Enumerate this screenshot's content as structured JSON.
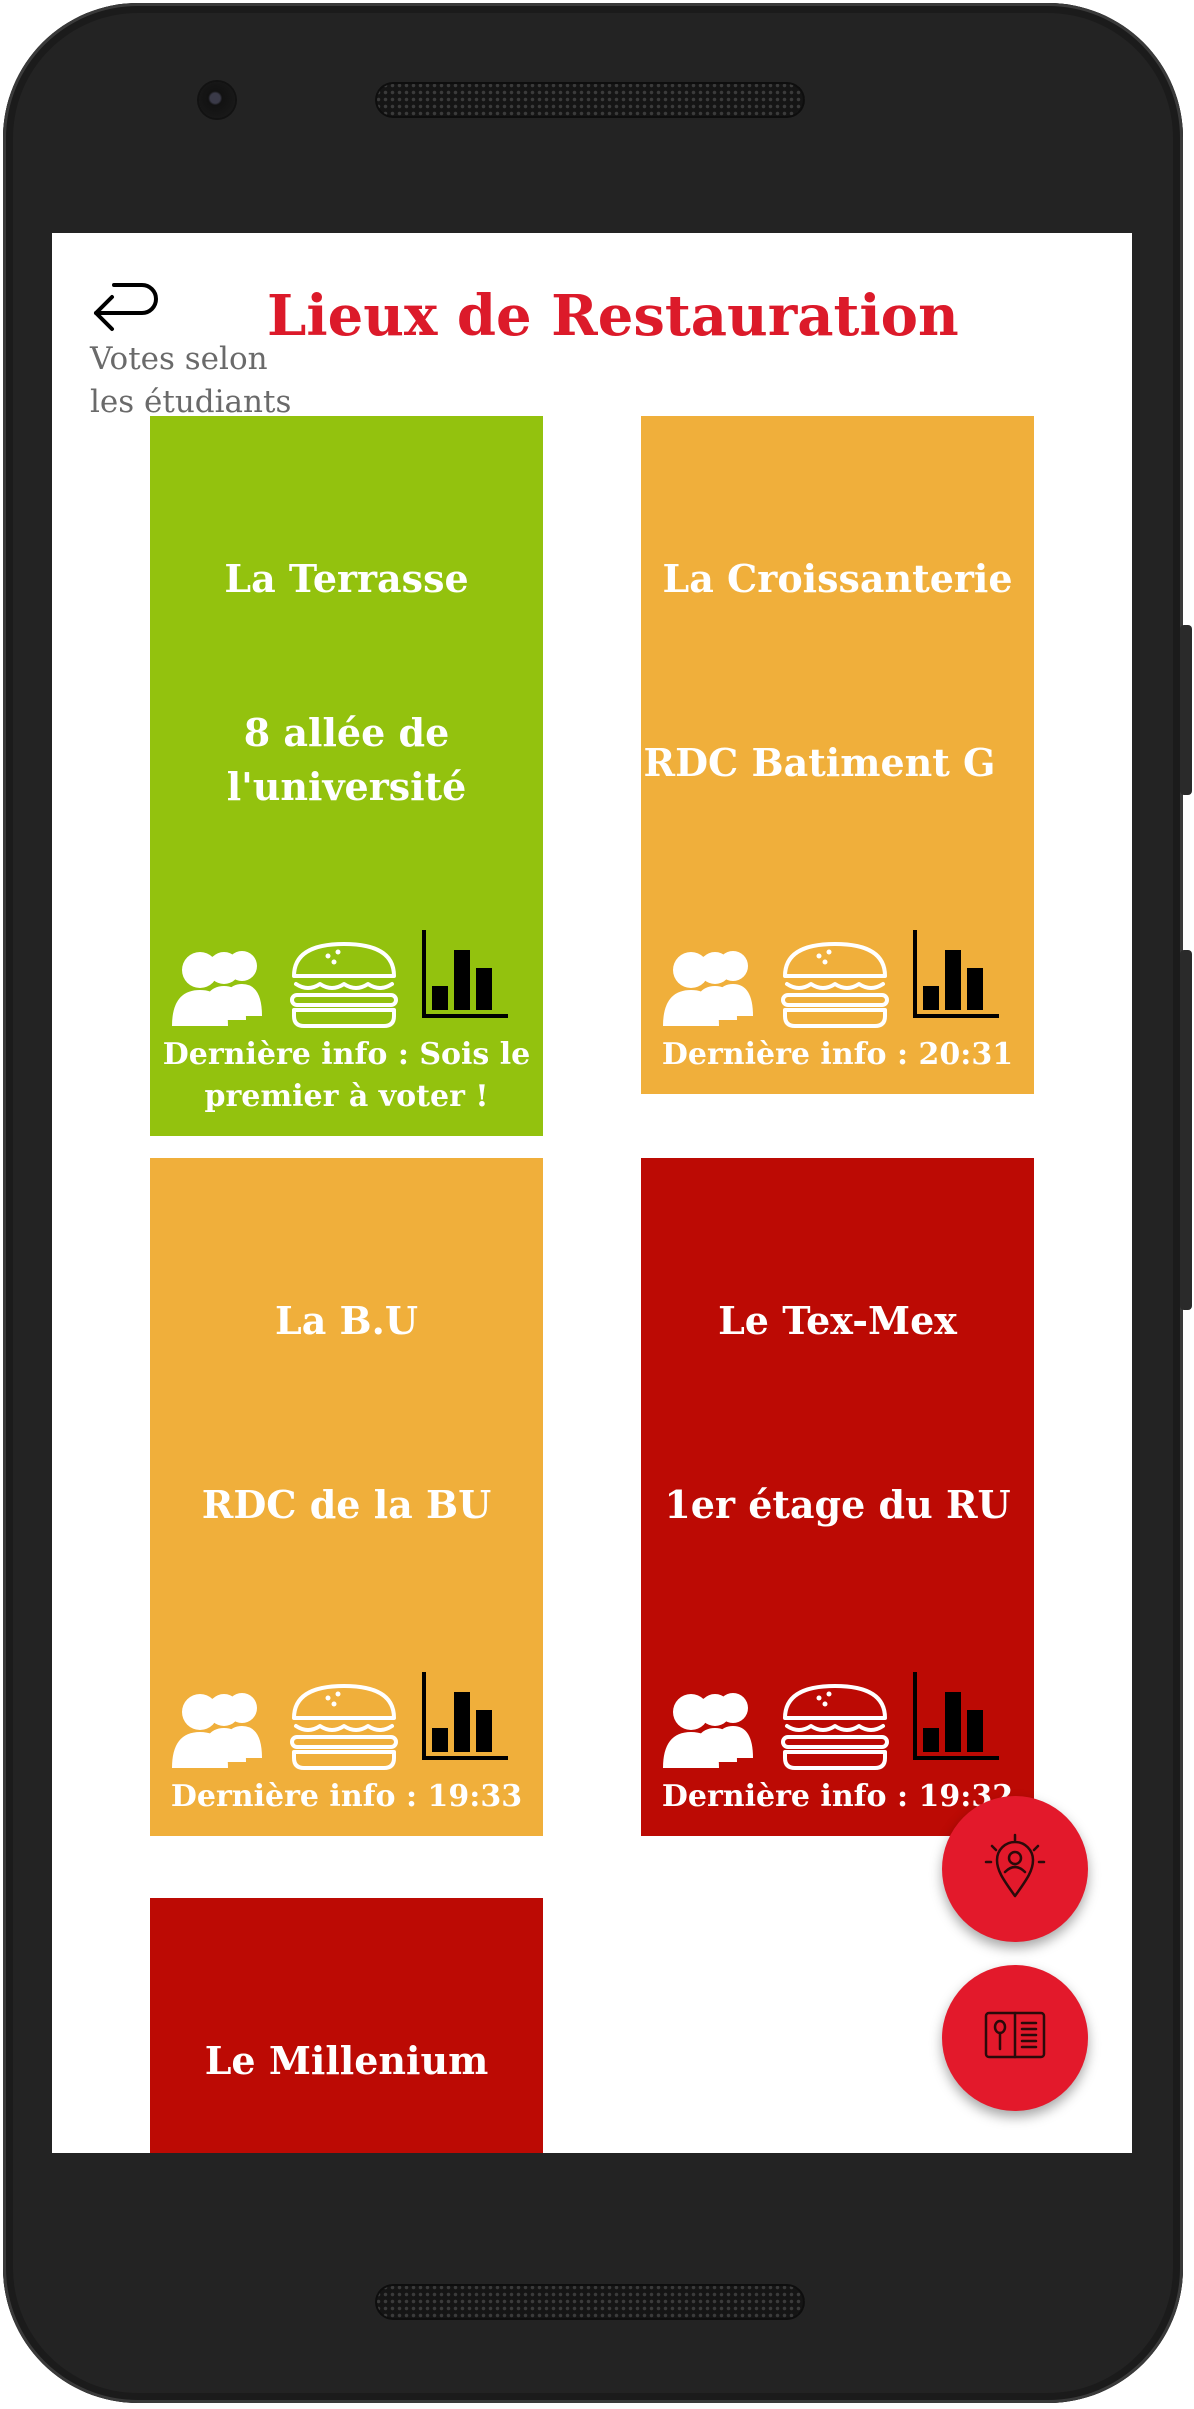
{
  "header": {
    "title": "Lieux de Restauration",
    "votes_label_line1": "Votes selon",
    "votes_label_line2": "les étudiants"
  },
  "colors": {
    "green": "#93c20e",
    "orange": "#f0af3b",
    "red": "#bc0a04",
    "title_red": "#dc1a2a",
    "fab_red": "#e3192b"
  },
  "icons": [
    "back-arrow-icon",
    "people-icon",
    "burger-icon",
    "bar-chart-icon",
    "location-pin-icon",
    "menu-book-icon"
  ],
  "restaurants": [
    {
      "name": "La Terrasse",
      "address_line1": "8 allée de",
      "address_line2": "l'université",
      "last_info_line1": "Dernière info : Sois le",
      "last_info_line2": "premier à voter !",
      "status_color": "green"
    },
    {
      "name": "La Croissanterie",
      "address_line1": "RDC Batiment G",
      "last_info_line1": "Dernière info : 20:31",
      "status_color": "orange"
    },
    {
      "name": "La B.U",
      "address_line1": "RDC de la BU",
      "last_info_line1": "Dernière info : 19:33",
      "status_color": "orange"
    },
    {
      "name": "Le Tex-Mex",
      "address_line1": "1er étage du RU",
      "last_info_line1": "Dernière info : 19:32",
      "status_color": "red"
    },
    {
      "name": "Le Millenium",
      "status_color": "red"
    }
  ]
}
